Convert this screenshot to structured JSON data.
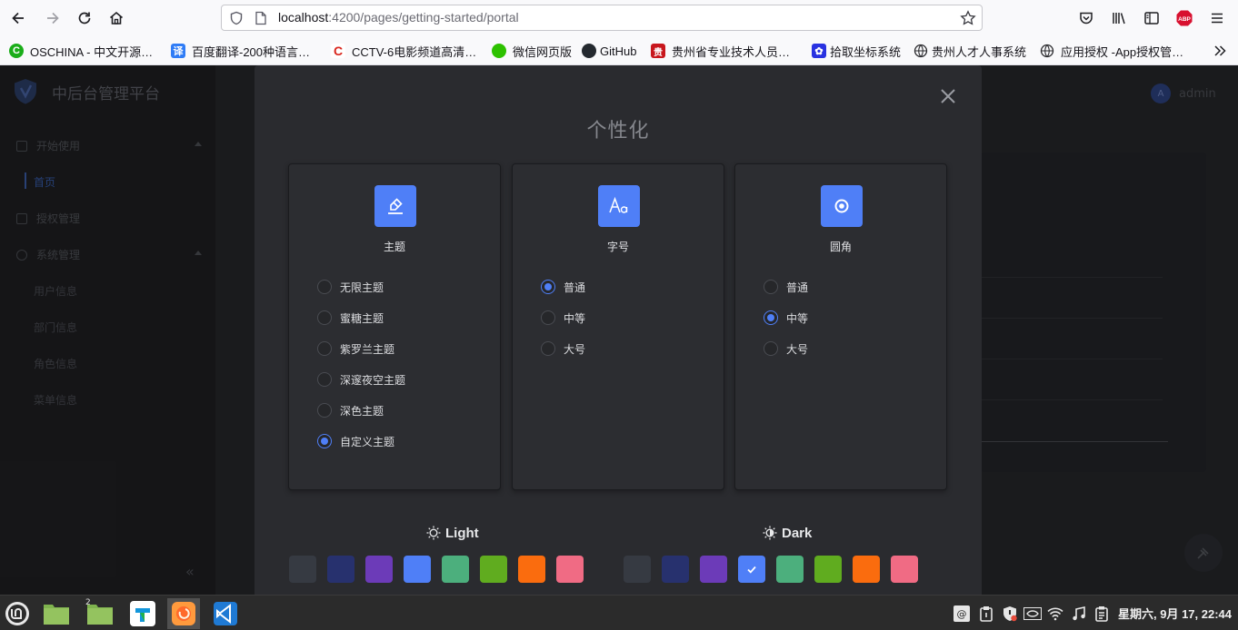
{
  "browser": {
    "url_host": "localhost",
    "url_path": ":4200/pages/getting-started/portal",
    "bookmarks": [
      {
        "label": "OSCHINA - 中文开源…",
        "icon": "oschina-icon",
        "color": "#1aad19",
        "glyph": "C"
      },
      {
        "label": "百度翻译-200种语言…",
        "icon": "baidu-translate-icon",
        "color": "#2f7cf6",
        "glyph": "译"
      },
      {
        "label": "CCTV-6电影频道高清…",
        "icon": "cctv-icon",
        "color": "#d9251d",
        "glyph": "C"
      },
      {
        "label": "微信网页版",
        "icon": "wechat-icon",
        "color": "#2dc100",
        "glyph": "●"
      },
      {
        "label": "GitHub",
        "icon": "github-icon",
        "color": "#24292f",
        "glyph": "●"
      },
      {
        "label": "贵州省专业技术人员…",
        "icon": "gz-pro-icon",
        "color": "#c8161d",
        "glyph": "贵"
      },
      {
        "label": "拾取坐标系统",
        "icon": "baidu-paw-icon",
        "color": "#2932e1",
        "glyph": "✿"
      },
      {
        "label": "贵州人才人事系统",
        "icon": "globe-icon",
        "color": "#ffffff",
        "glyph": ""
      },
      {
        "label": "应用授权 -App授权管…",
        "icon": "globe-icon",
        "color": "#ffffff",
        "glyph": ""
      }
    ]
  },
  "app": {
    "title": "中后台管理平台",
    "user": "admin",
    "avatar_letter": "A",
    "menu": [
      {
        "label": "开始使用",
        "expanded": true
      },
      {
        "label": "授权管理",
        "expanded": false
      },
      {
        "label": "系统管理",
        "expanded": true
      }
    ],
    "sub_start": [
      "首页"
    ],
    "sub_system": [
      "用户信息",
      "部门信息",
      "角色信息",
      "菜单信息"
    ],
    "collapse_glyph": "«"
  },
  "modal": {
    "title": "个性化",
    "panels": [
      {
        "title": "主题",
        "icon": "highlighter-icon",
        "options": [
          "无限主题",
          "蜜糖主题",
          "紫罗兰主题",
          "深邃夜空主题",
          "深色主题",
          "自定义主题"
        ],
        "selected": 5
      },
      {
        "title": "字号",
        "icon": "font-size-icon",
        "options": [
          "普通",
          "中等",
          "大号"
        ],
        "selected": 0
      },
      {
        "title": "圆角",
        "icon": "radius-icon",
        "options": [
          "普通",
          "中等",
          "大号"
        ],
        "selected": 1
      }
    ],
    "light_label": "Light",
    "dark_label": "Dark",
    "light_colors": [
      "#363a42",
      "#27316e",
      "#6c3bb8",
      "#4f7ff7",
      "#4caf7d",
      "#60ac1f",
      "#fa6c0e",
      "#f06b84"
    ],
    "dark_colors": [
      "#363a42",
      "#27316e",
      "#6c3bb8",
      "#4f7ff7",
      "#4caf7d",
      "#60ac1f",
      "#fa6c0e",
      "#f06b84"
    ],
    "dark_selected": 3
  },
  "taskbar": {
    "clock": "星期六, 9月 17, 22:44",
    "files_badge": "2"
  }
}
